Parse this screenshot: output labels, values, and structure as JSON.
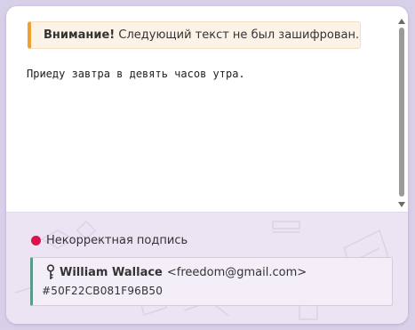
{
  "warning": {
    "title": "Внимание!",
    "text": "Следующий текст не был зашифрован."
  },
  "message": {
    "body": "Приеду завтра в девять часов утра."
  },
  "signature": {
    "status": "Некорректная подпись",
    "status_color": "#e0104a",
    "signer_name": "William Wallace",
    "signer_email": "<freedom@gmail.com>",
    "key_id": "#50F22CB081F96B50",
    "key_icon": "key-icon"
  }
}
